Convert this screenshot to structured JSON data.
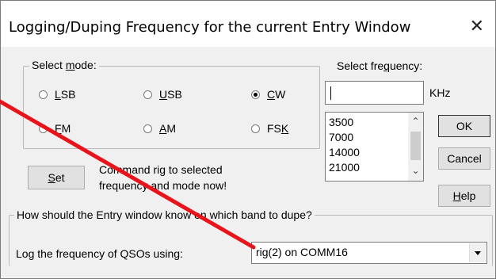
{
  "window": {
    "title": "Logging/Duping Frequency for the current Entry Window",
    "close_glyph": "✕"
  },
  "mode_group": {
    "legend_pre": "Select ",
    "legend_ul": "m",
    "legend_post": "ode:",
    "options": [
      {
        "pre": "",
        "ul": "L",
        "post": "SB",
        "selected": false
      },
      {
        "pre": "",
        "ul": "U",
        "post": "SB",
        "selected": false
      },
      {
        "pre": "",
        "ul": "C",
        "post": "W",
        "selected": true
      },
      {
        "pre": "",
        "ul": "F",
        "post": "M",
        "selected": false
      },
      {
        "pre": "",
        "ul": "A",
        "post": "M",
        "selected": false
      },
      {
        "pre": "FS",
        "ul": "K",
        "post": "",
        "selected": false
      }
    ]
  },
  "frequency": {
    "label_pre": "Select fre",
    "label_ul": "q",
    "label_post": "uency:",
    "input_value": "",
    "unit": "KHz",
    "list": [
      "3500",
      "7000",
      "14000",
      "21000"
    ]
  },
  "buttons": {
    "set_ul": "S",
    "set_post": "et",
    "ok": "OK",
    "cancel": "Cancel",
    "help_ul": "H",
    "help_post": "elp"
  },
  "command_text": {
    "line1": "Command rig to selected",
    "line2": "frequency and mode now!"
  },
  "dupe_group": {
    "legend": "How should the Entry window know on which band to dupe?",
    "log_label": "Log the frequency of QSOs using:",
    "combo_value": "rig(2) on COMM16"
  },
  "colors": {
    "annotation_line": "#e8141b"
  }
}
